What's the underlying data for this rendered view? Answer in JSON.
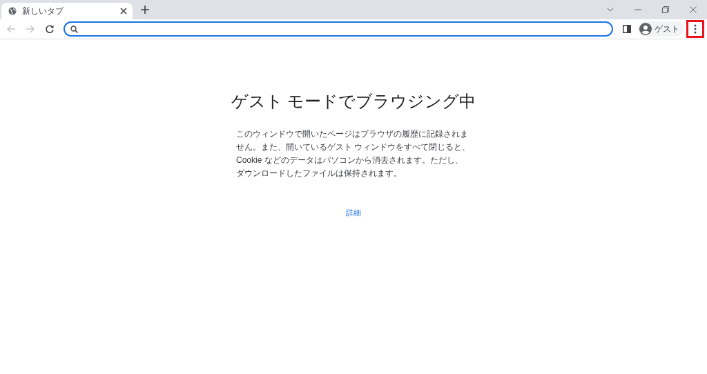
{
  "tabs": [
    {
      "title": "新しいタブ",
      "selected": true
    }
  ],
  "toolbar": {
    "back_disabled": true,
    "forward_disabled": true,
    "profile": {
      "label": "ゲスト"
    },
    "menu": {
      "highlighted": true
    }
  },
  "page": {
    "heading": "ゲスト モードでブラウジング中",
    "body": "このウィンドウで開いたページはブラウザの履歴に記録されません。また、開いているゲスト ウィンドウをすべて閉じると、Cookie などのデータはパソコンから消去されます。ただし、ダウンロードしたファイルは保持されます。",
    "link": "詳細"
  }
}
